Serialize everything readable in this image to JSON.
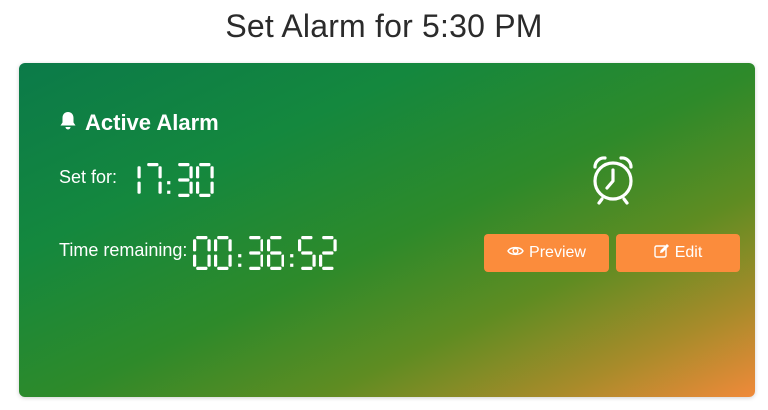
{
  "page": {
    "title": "Set Alarm for 5:30 PM"
  },
  "card": {
    "header_title": "Active Alarm",
    "set_for_label": "Set for:",
    "set_for_value": "17:30",
    "remaining_label": "Time remaining:",
    "remaining_value": "00:36:52",
    "preview_label": "Preview",
    "edit_label": "Edit"
  },
  "colors": {
    "gradient_start": "#0b7a49",
    "gradient_end": "#f08a3a",
    "button": "#fb8c3c",
    "title_text": "#2b2b2b"
  },
  "icons": {
    "header": "bell-icon",
    "clock": "alarm-clock-icon",
    "preview": "eye-icon",
    "edit": "edit-icon"
  }
}
